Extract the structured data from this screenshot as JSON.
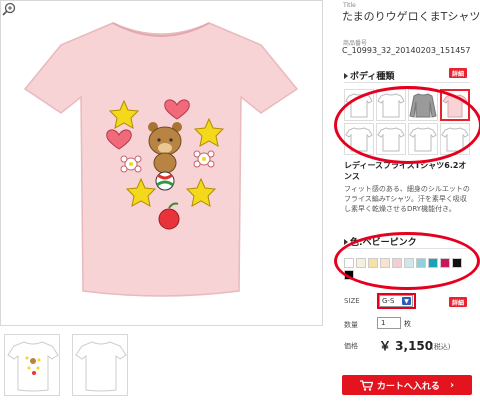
{
  "product": {
    "title_label": "Title",
    "title": "たまのりウゲロくまTシャツ",
    "code_label": "商品番号",
    "code": "C_10993_32_20140203_151457"
  },
  "body_type": {
    "heading": "ボディ種類",
    "detail_label": "詳細",
    "selected_index": 3,
    "name": "レディースプライスTシャツ6.2オンス",
    "description": "フィット感のある、細身のシルエットのフライス編みTシャツ。汗を素早く吸収し素早く乾燥させるDRY機能付き。"
  },
  "color": {
    "heading": "色:ベビーピンク",
    "swatches": [
      "#ffffff",
      "#f5f1de",
      "#f7e2a6",
      "#f8e2d2",
      "#f2cfd6",
      "#cfe6ea",
      "#8fd0db",
      "#1aa3b8",
      "#c9175a",
      "#111111",
      "#000000"
    ]
  },
  "size": {
    "label": "SIZE",
    "value": "G-S",
    "detail_label": "詳細"
  },
  "quantity": {
    "label": "数量",
    "value": "1",
    "unit": "枚"
  },
  "price": {
    "label": "価格",
    "value": "￥ 3,150",
    "tax_note": "(税込)"
  },
  "cart": {
    "label": "カートへ入れる",
    "icon": "cart-icon"
  },
  "colors": {
    "accent": "#e3141e",
    "shirt_pink": "#f7d3d6",
    "annotation": "#e6001f"
  }
}
